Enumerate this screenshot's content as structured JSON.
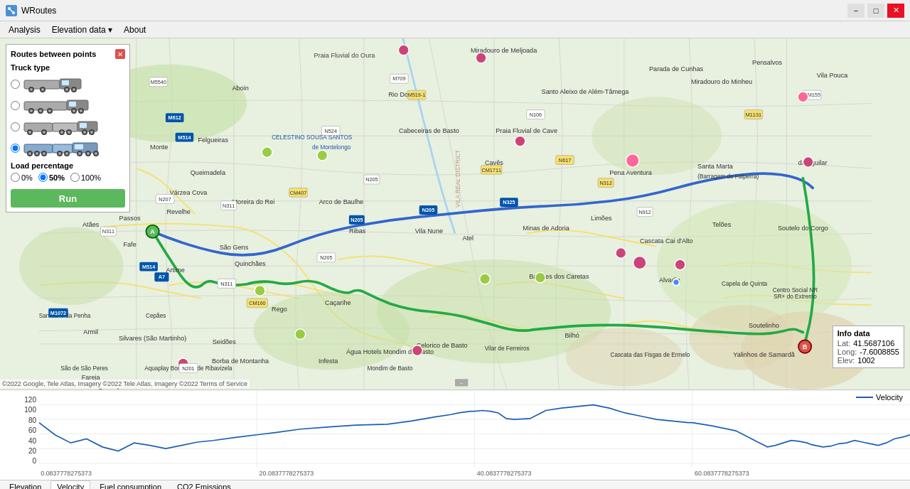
{
  "app": {
    "title": "WRoutes",
    "icon": "route-icon"
  },
  "titlebar": {
    "title": "WRoutes",
    "minimize_label": "−",
    "maximize_label": "□",
    "close_label": "✕"
  },
  "menubar": {
    "items": [
      {
        "id": "analysis",
        "label": "Analysis"
      },
      {
        "id": "elevation-data",
        "label": "Elevation data"
      },
      {
        "id": "about",
        "label": "About"
      }
    ]
  },
  "side_panel": {
    "title": "Routes between points",
    "close_label": "✕",
    "truck_section_title": "Truck type",
    "trucks": [
      {
        "id": "truck1",
        "label": "truck-type-1"
      },
      {
        "id": "truck2",
        "label": "truck-type-2"
      },
      {
        "id": "truck3",
        "label": "truck-type-3"
      },
      {
        "id": "truck4",
        "label": "truck-type-4",
        "selected": true
      }
    ],
    "load_section_title": "Load percentage",
    "load_options": [
      {
        "id": "load0",
        "label": "0%"
      },
      {
        "id": "load50",
        "label": "50%",
        "selected": true
      },
      {
        "id": "load100",
        "label": "100%"
      }
    ],
    "run_button_label": "Run"
  },
  "info_box": {
    "title": "Info data",
    "lat_label": "Lat:",
    "lat_value": "41.5687106",
    "lon_label": "Long:",
    "lon_value": "-7.6008855",
    "elev_label": "Elev:",
    "elev_value": "1002"
  },
  "map_attribution": "©2022 Google, Tele Atlas, Imagery ©2022 Tele Atlas, Imagery ©2022 Terms of Service",
  "chart": {
    "y_axis_labels": [
      "120",
      "100",
      "80",
      "60",
      "40",
      "20",
      "0"
    ],
    "x_axis_labels": [
      "0.0837778275373",
      "20.0837778275373",
      "40.0837778275373",
      "60.0837778275373"
    ],
    "legend_label": "Velocity",
    "legend_color": "#1a5fb4"
  },
  "bottom_tabs": [
    {
      "id": "elevation",
      "label": "Elevation"
    },
    {
      "id": "velocity",
      "label": "Velocity",
      "active": true
    },
    {
      "id": "fuel",
      "label": "Fuel consumption"
    },
    {
      "id": "co2",
      "label": "CO2 Emissions"
    }
  ],
  "bottom_controls": {
    "input1_value": "",
    "input2_value": "",
    "separator": "--"
  }
}
